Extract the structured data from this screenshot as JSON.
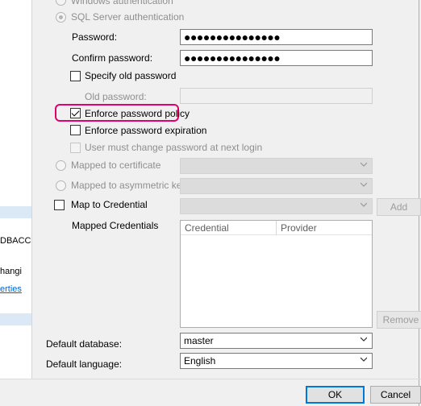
{
  "auth": {
    "windows_label": "Windows authentication",
    "sql_label": "SQL Server authentication"
  },
  "fields": {
    "password_label": "Password:",
    "password_value": "●●●●●●●●●●●●●●●",
    "confirm_label": "Confirm password:",
    "confirm_value": "●●●●●●●●●●●●●●●",
    "specify_old_label": "Specify old password",
    "old_password_label": "Old password:"
  },
  "policy": {
    "enforce_policy_label": "Enforce password policy",
    "enforce_policy_checked": true,
    "enforce_expiration_label": "Enforce password expiration",
    "must_change_label": "User must change password at next login"
  },
  "mapping": {
    "certificate_label": "Mapped to certificate",
    "asym_key_label": "Mapped to asymmetric key",
    "credential_label": "Map to Credential",
    "add_button": "Add",
    "mapped_credentials_label": "Mapped Credentials",
    "columns": [
      "Credential",
      "Provider"
    ],
    "remove_button": "Remove"
  },
  "defaults": {
    "database_label": "Default database:",
    "database_value": "master",
    "language_label": "Default language:",
    "language_value": "English"
  },
  "left_panel": {
    "text1": "DBACC",
    "text2": "hangi",
    "link": "erties"
  },
  "buttons": {
    "ok": "OK",
    "cancel": "Cancel"
  },
  "colors": {
    "highlight": "#e0006f",
    "ok_border": "#0078d7",
    "link": "#0066cc"
  }
}
